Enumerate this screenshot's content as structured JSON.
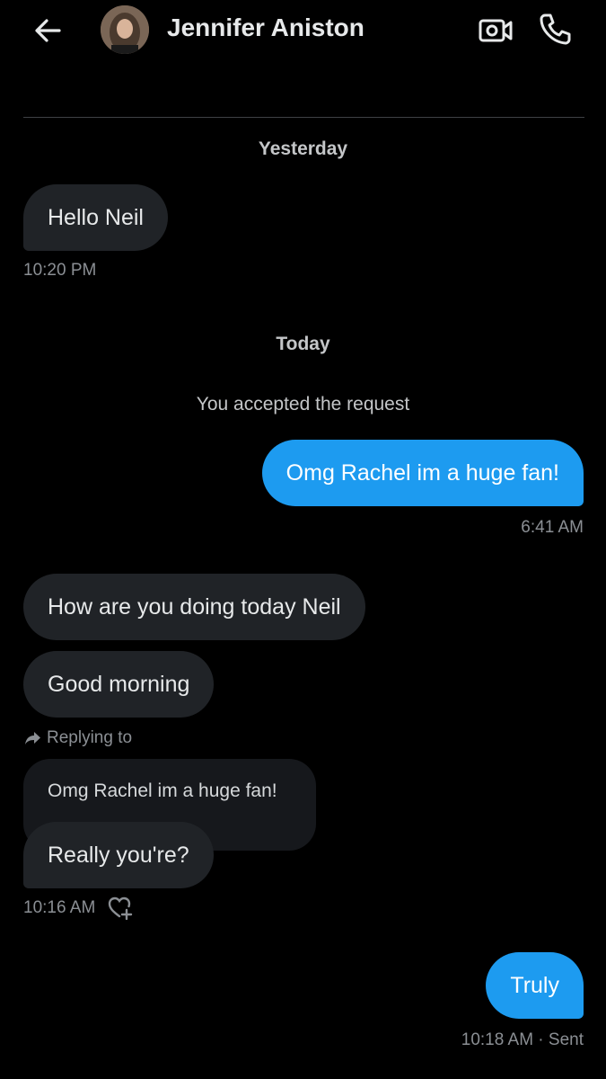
{
  "header": {
    "title": "Jennifer Aniston",
    "icons": {
      "back": "arrow-left-icon",
      "video": "video-camera-icon",
      "call": "phone-icon"
    }
  },
  "conversation": {
    "date_yesterday": "Yesterday",
    "date_today": "Today",
    "system_message": "You accepted the request",
    "messages": [
      {
        "direction": "in",
        "text": "Hello Neil",
        "time": "10:20 PM"
      },
      {
        "direction": "out",
        "text": "Omg Rachel im a huge fan!",
        "time": "6:41 AM"
      },
      {
        "direction": "in",
        "text": "How are you doing today Neil"
      },
      {
        "direction": "in",
        "text": "Good morning"
      },
      {
        "direction": "in",
        "reply_label": "Replying to",
        "quoted_text": "Omg Rachel im a huge fan!",
        "text": "Really you're?",
        "time": "10:16 AM"
      },
      {
        "direction": "out",
        "text": "Truly",
        "time": "10:18 AM · Sent"
      }
    ]
  },
  "colors": {
    "background": "#000000",
    "incoming_bubble": "#202327",
    "outgoing_bubble": "#1d9bf0",
    "secondary_text": "#8b8f94"
  }
}
